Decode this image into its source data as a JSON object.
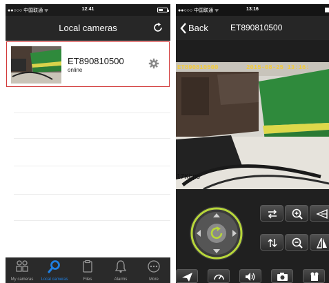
{
  "left_screen": {
    "status": {
      "carrier": "●●○○○ 中国联通 ᯤ",
      "time": "12:41"
    },
    "nav": {
      "title": "Local cameras",
      "refresh_icon": "refresh-icon"
    },
    "cameras": [
      {
        "name": "ET890810500",
        "status": "online",
        "settings_icon": "gear-icon"
      }
    ],
    "tabs": [
      {
        "label": "My cameras",
        "icon": "cameras-icon",
        "active": false
      },
      {
        "label": "Local cameras",
        "icon": "search-icon",
        "active": true
      },
      {
        "label": "Files",
        "icon": "files-icon",
        "active": false
      },
      {
        "label": "Alarms",
        "icon": "bell-icon",
        "active": false
      },
      {
        "label": "More",
        "icon": "more-icon",
        "active": false
      }
    ],
    "colors": {
      "selection_border": "#d23a3a",
      "active_tab": "#1f7fe0",
      "bar": "#272727"
    }
  },
  "right_screen": {
    "status": {
      "carrier": "●●○○○ 中国联通 ᯤ",
      "time": "13:16"
    },
    "nav": {
      "back_label": "Back",
      "title": "ET890810500"
    },
    "video": {
      "osd_camera_id": "ET890810500",
      "osd_timestamp": "2015-08-25 13:16:",
      "bitrate": "17Kbps"
    },
    "controls": {
      "ptz_center_icon": "refresh-icon",
      "right_buttons": [
        "swap-horizontal-icon",
        "zoom-in-icon",
        "flip-horizontal-icon",
        "swap-vertical-icon",
        "zoom-out-icon",
        "mirror-icon"
      ],
      "bottom_buttons": [
        "send-icon",
        "speed-icon",
        "volume-icon",
        "camera-icon",
        "record-icon"
      ]
    },
    "colors": {
      "osd": "#f4cc3a",
      "ptz_ring": "#b7d63a"
    }
  }
}
